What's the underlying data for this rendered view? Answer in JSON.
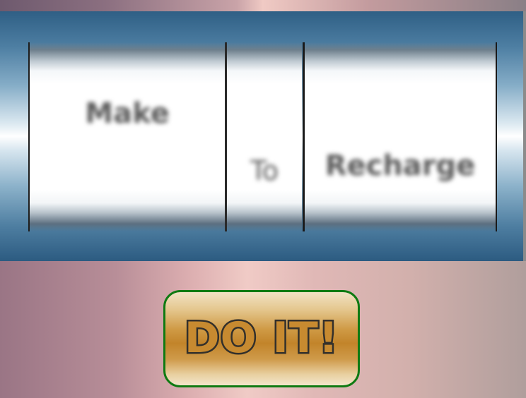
{
  "slot_machine": {
    "reels": [
      {
        "word": "Make"
      },
      {
        "word": "To"
      },
      {
        "word": "Recharge"
      }
    ]
  },
  "action_button": {
    "label": "DO IT!",
    "border_color": "#0f7a12",
    "fill_color": "#c2842a"
  }
}
